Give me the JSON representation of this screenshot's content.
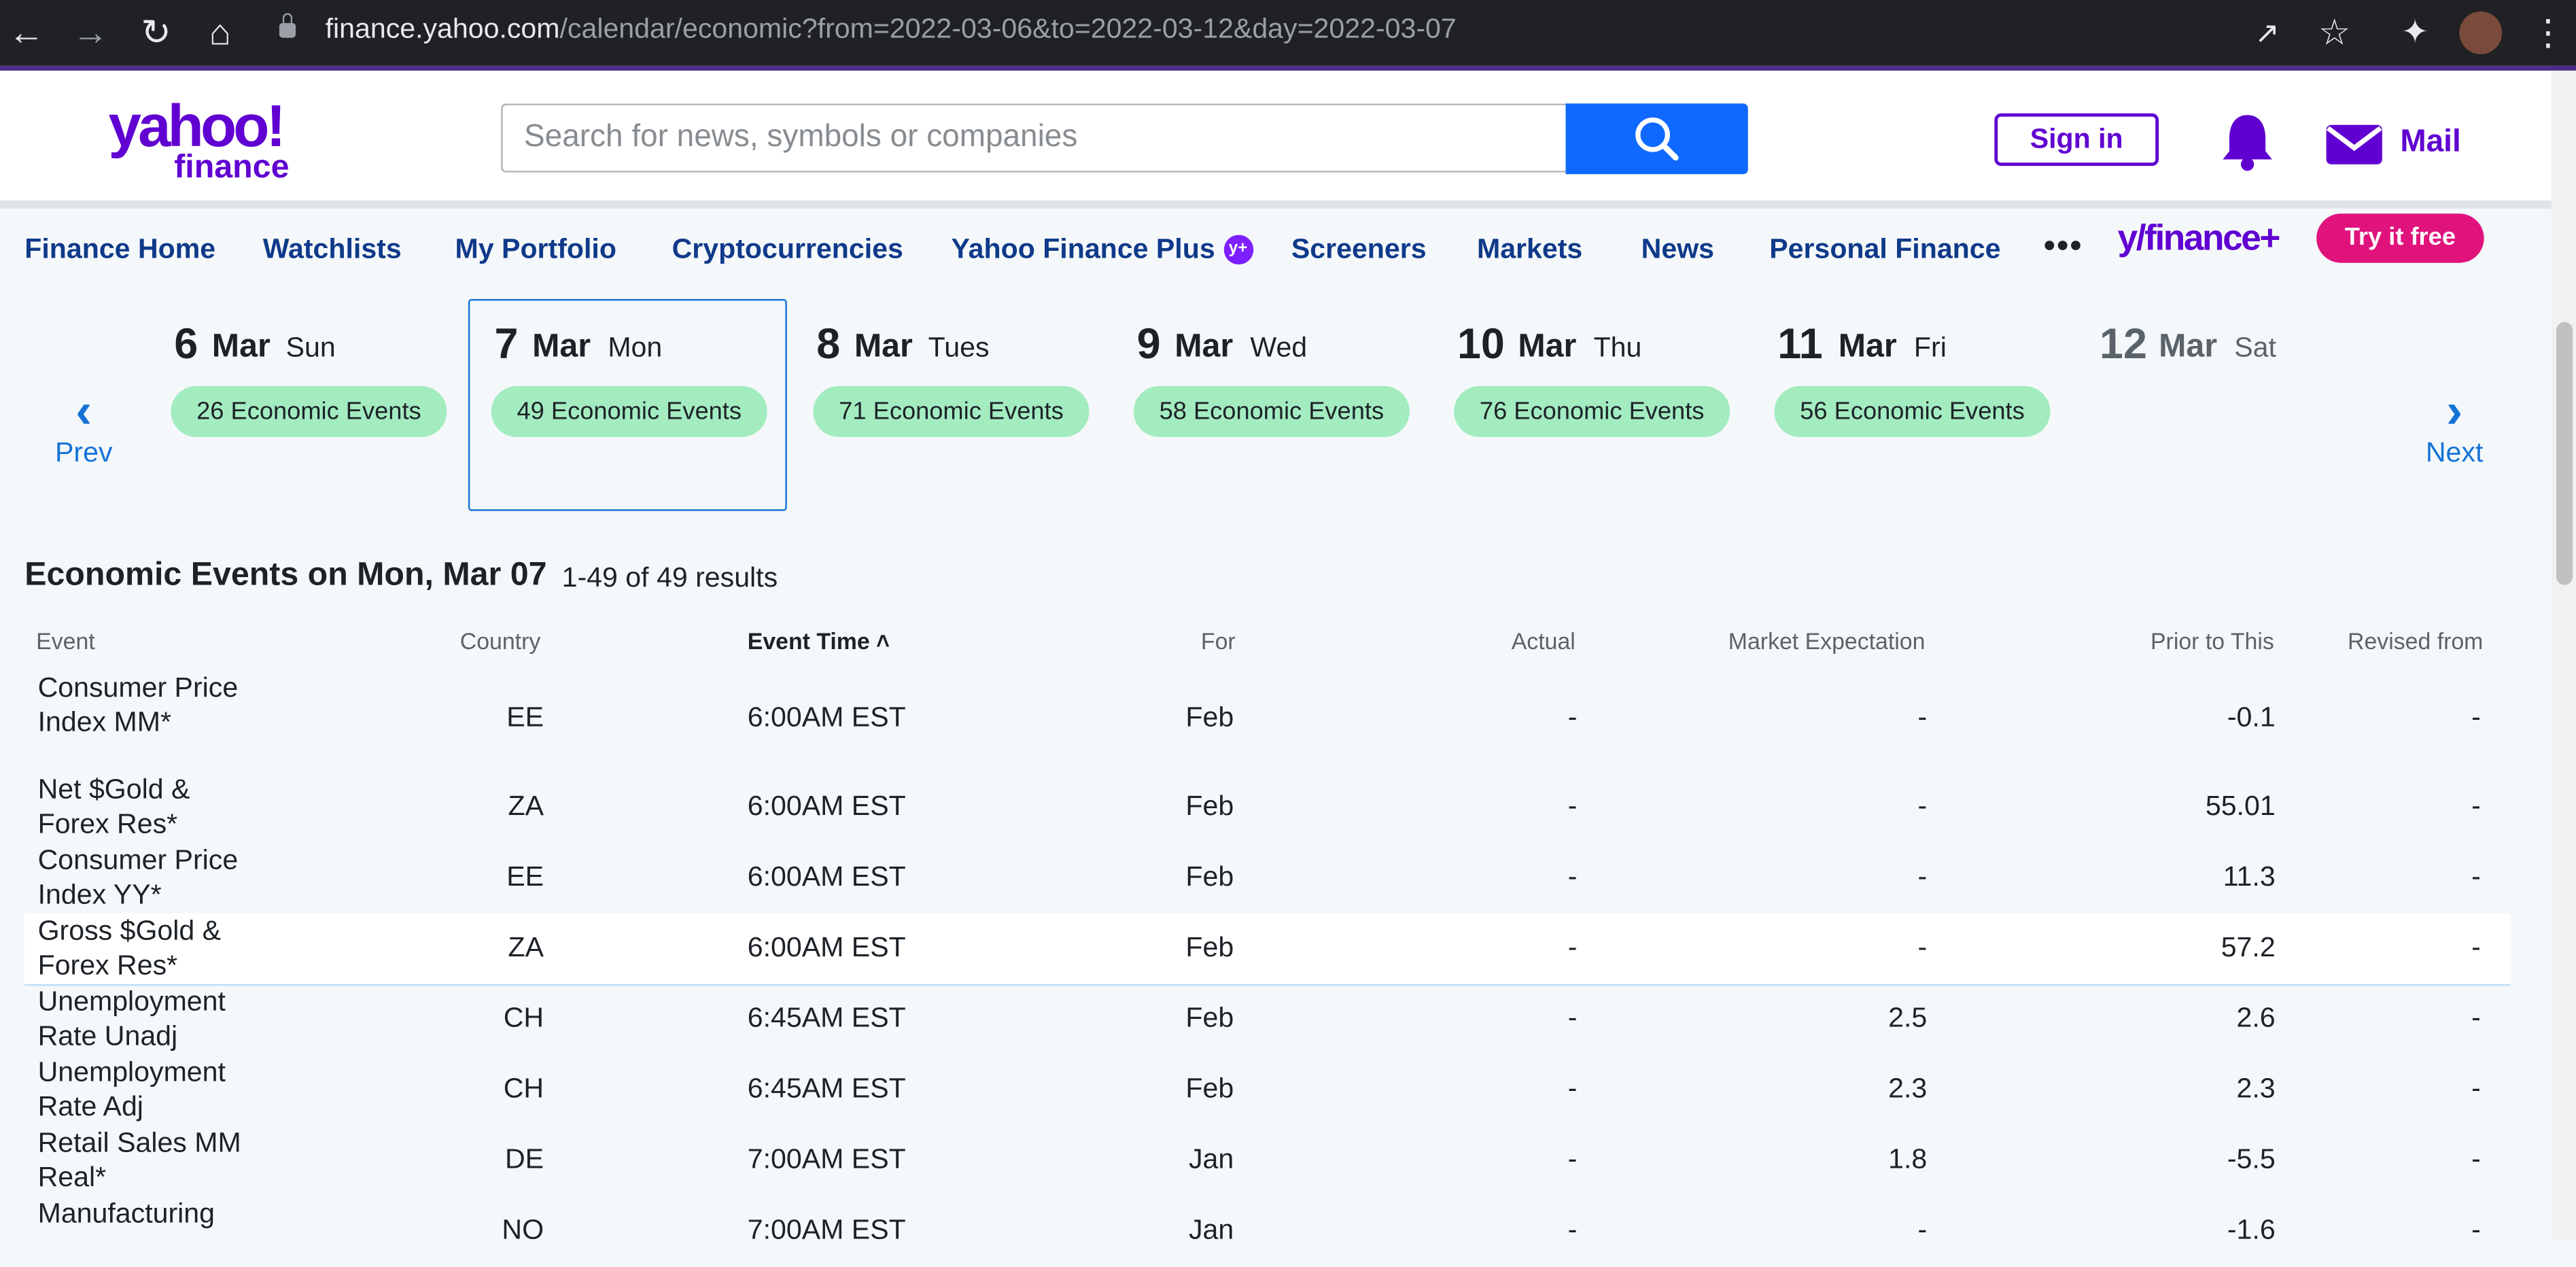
{
  "browser": {
    "url_host": "finance.yahoo.com",
    "url_path": "/calendar/economic?from=2022-03-06&to=2022-03-12&day=2022-03-07"
  },
  "header": {
    "logo_top": "yahoo!",
    "logo_bottom": "finance",
    "search_placeholder": "Search for news, symbols or companies",
    "signin_label": "Sign in",
    "mail_label": "Mail"
  },
  "nav": {
    "items": [
      "Finance Home",
      "Watchlists",
      "My Portfolio",
      "Cryptocurrencies",
      "Yahoo Finance Plus",
      "Screeners",
      "Markets",
      "News",
      "Personal Finance"
    ],
    "more": "•••",
    "yfplus_logo": "y/finance+",
    "try_label": "Try it free"
  },
  "dates": {
    "prev_label": "Prev",
    "next_label": "Next",
    "days": [
      {
        "num": "6",
        "mon": "Mar",
        "dow": "Sun",
        "events": "26 Economic Events"
      },
      {
        "num": "7",
        "mon": "Mar",
        "dow": "Mon",
        "events": "49 Economic Events"
      },
      {
        "num": "8",
        "mon": "Mar",
        "dow": "Tues",
        "events": "71 Economic Events"
      },
      {
        "num": "9",
        "mon": "Mar",
        "dow": "Wed",
        "events": "58 Economic Events"
      },
      {
        "num": "10",
        "mon": "Mar",
        "dow": "Thu",
        "events": "76 Economic Events"
      },
      {
        "num": "11",
        "mon": "Mar",
        "dow": "Fri",
        "events": "56 Economic Events"
      },
      {
        "num": "12",
        "mon": "Mar",
        "dow": "Sat",
        "events": ""
      }
    ],
    "selected": "7 Mar"
  },
  "results": {
    "title": "Economic Events on Mon, Mar 07",
    "count": "1-49 of 49 results"
  },
  "table": {
    "headers": [
      "Event",
      "Country",
      "Event Time ^",
      "For",
      "Actual",
      "Market Expectation",
      "Prior to This",
      "Revised from"
    ],
    "rows": [
      [
        "Consumer Price Index MM*",
        "EE",
        "6:00AM EST",
        "Feb",
        "-",
        "-",
        "-0.1",
        "-"
      ],
      [
        "Net $Gold & Forex Res*",
        "ZA",
        "6:00AM EST",
        "Feb",
        "-",
        "-",
        "55.01",
        "-"
      ],
      [
        "Consumer Price Index YY*",
        "EE",
        "6:00AM EST",
        "Feb",
        "-",
        "-",
        "11.3",
        "-"
      ],
      [
        "Gross $Gold & Forex Res*",
        "ZA",
        "6:00AM EST",
        "Feb",
        "-",
        "-",
        "57.2",
        "-"
      ],
      [
        "Unemployment Rate Unadj",
        "CH",
        "6:45AM EST",
        "Feb",
        "-",
        "2.5",
        "2.6",
        "-"
      ],
      [
        "Unemployment Rate Adj",
        "CH",
        "6:45AM EST",
        "Feb",
        "-",
        "2.3",
        "2.3",
        "-"
      ],
      [
        "Retail Sales MM Real*",
        "DE",
        "7:00AM EST",
        "Jan",
        "-",
        "1.8",
        "-5.5",
        "-"
      ],
      [
        "Manufacturing",
        "NO",
        "7:00AM EST",
        "Jan",
        "-",
        "-",
        "-1.6",
        "-"
      ]
    ]
  },
  "colors": {
    "yahoo_purple": "#6001d2",
    "search_blue": "#0f69ff",
    "pill_green": "#a3ecc0",
    "try_pink": "#e0137d",
    "link_blue": "#1573d8"
  }
}
